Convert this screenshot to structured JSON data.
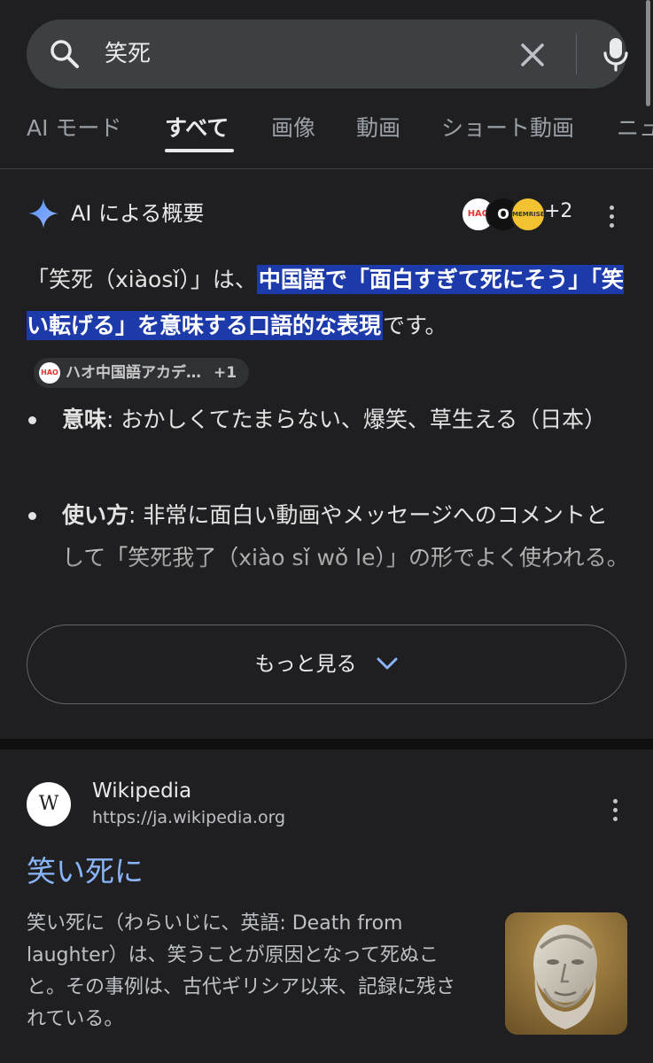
{
  "search": {
    "query": "笑死"
  },
  "tabs": [
    {
      "label": "AI モード"
    },
    {
      "label": "すべて"
    },
    {
      "label": "画像"
    },
    {
      "label": "動画"
    },
    {
      "label": "ショート動画"
    },
    {
      "label": "ニュ"
    }
  ],
  "ai_overview": {
    "title": "AI による概要",
    "source_icons": [
      "HAO",
      "O",
      "MEMRISE"
    ],
    "source_more": "+2",
    "intro_pre": "「笑死（xiàosǐ）」は、",
    "intro_highlight": "中国語で「面白すぎて死にそう」「笑い転げる」を意味する口語的な表現",
    "intro_post": "です。",
    "citation": {
      "label": "ハオ中国語アカデ…",
      "more": "+1"
    },
    "bullets": [
      {
        "term": "意味",
        "text": ": おかしくてたまらない、爆笑、草生える（日本）"
      },
      {
        "term": "使い方",
        "text": ": 非常に面白い動画やメッセージへのコメントとして「笑死我了（xiào sǐ wǒ le）」の形でよく使われる。"
      }
    ],
    "show_more": "もっと見る"
  },
  "result": {
    "favicon": "W",
    "site_name": "Wikipedia",
    "url": "https://ja.wikipedia.org",
    "title": "笑い死に",
    "snippet": "笑い死に（わらいじに、英語: Death from laughter）は、笑うことが原因となって死ぬこと。その事例は、古代ギリシア以来、記録に残されている。"
  }
}
